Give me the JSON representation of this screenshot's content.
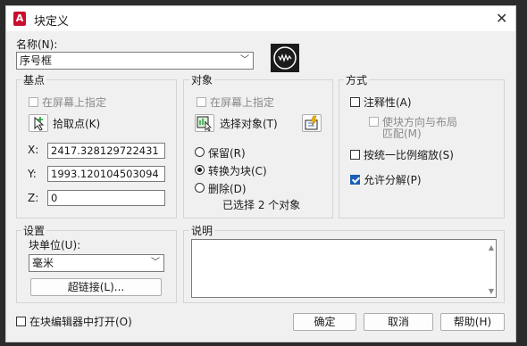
{
  "window": {
    "title": "块定义",
    "app_icon": "A"
  },
  "name": {
    "label": "名称(N):",
    "value": "序号框"
  },
  "base_point": {
    "title": "基点",
    "specify_on_screen": "在屏幕上指定",
    "pick_point": "拾取点(K)",
    "x_label": "X:",
    "x_value": "2417.328129722431",
    "y_label": "Y:",
    "y_value": "1993.120104503094",
    "z_label": "Z:",
    "z_value": "0"
  },
  "objects": {
    "title": "对象",
    "specify_on_screen": "在屏幕上指定",
    "select_objects": "选择对象(T)",
    "retain": "保留(R)",
    "convert_to_block": "转换为块(C)",
    "delete": "删除(D)",
    "selected_info": "已选择 2 个对象"
  },
  "behavior": {
    "title": "方式",
    "annotative": "注释性(A)",
    "match_orientation": "使块方向与布局",
    "match_orientation_2": "匹配(M)",
    "scale_uniformly": "按统一比例缩放(S)",
    "allow_exploding": "允许分解(P)"
  },
  "settings": {
    "title": "设置",
    "block_unit_label": "块单位(U):",
    "block_unit_value": "毫米",
    "hyperlink": "超链接(L)..."
  },
  "description": {
    "title": "说明",
    "value": ""
  },
  "footer": {
    "open_in_editor": "在块编辑器中打开(O)",
    "ok": "确定",
    "cancel": "取消",
    "help": "帮助(H)"
  }
}
